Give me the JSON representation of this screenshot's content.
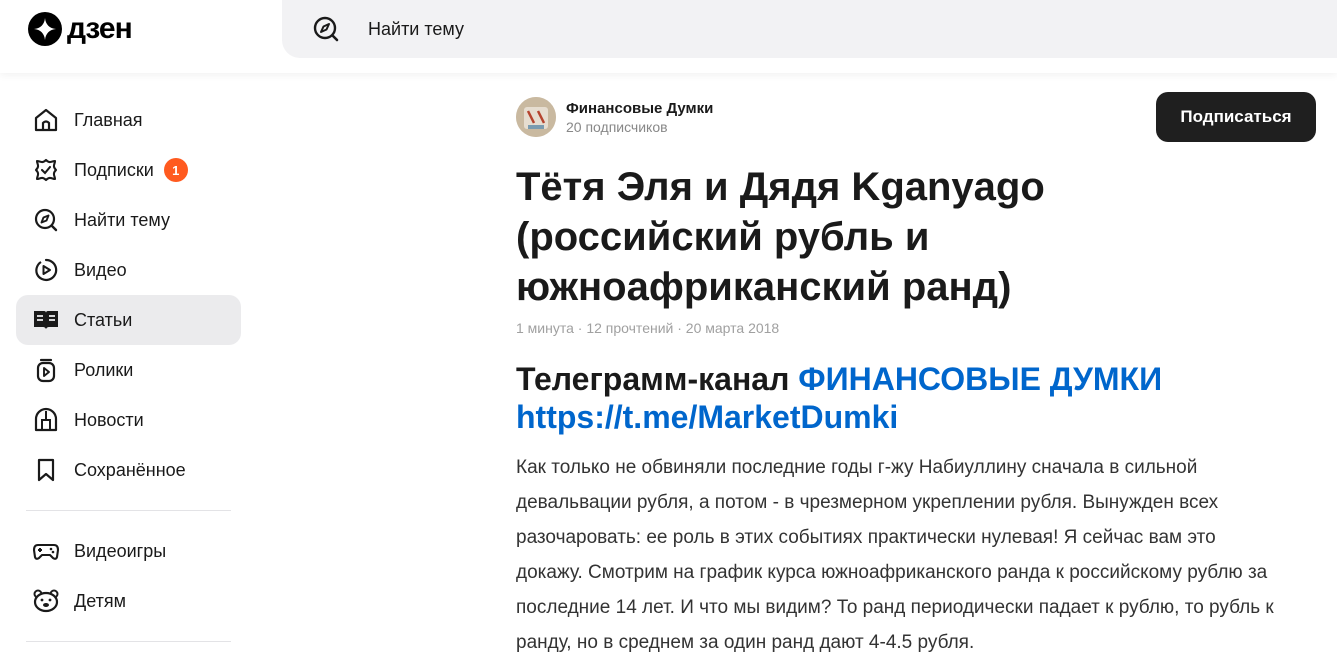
{
  "header": {
    "logo_text": "дзен",
    "search_placeholder": "Найти тему"
  },
  "sidebar": {
    "items": [
      {
        "label": "Главная",
        "icon": "home-icon"
      },
      {
        "label": "Подписки",
        "icon": "subscriptions-icon",
        "badge": "1"
      },
      {
        "label": "Найти тему",
        "icon": "compass-icon"
      },
      {
        "label": "Видео",
        "icon": "video-icon"
      },
      {
        "label": "Статьи",
        "icon": "articles-icon",
        "active": true
      },
      {
        "label": "Ролики",
        "icon": "shorts-icon"
      },
      {
        "label": "Новости",
        "icon": "news-icon"
      },
      {
        "label": "Сохранённое",
        "icon": "bookmark-icon"
      }
    ],
    "extra_items": [
      {
        "label": "Видеоигры",
        "icon": "gamepad-icon"
      },
      {
        "label": "Детям",
        "icon": "kids-icon"
      }
    ]
  },
  "channel": {
    "name": "Финансовые Думки",
    "subscribers": "20 подписчиков"
  },
  "subscribe_label": "Подписаться",
  "article": {
    "title": "Тётя Эля и Дядя Kganyago (российский рубль и южноафриканский ранд)",
    "meta": "1 минута · 12 прочтений · 20 марта 2018",
    "subhead_prefix": "Телеграмм-канал ",
    "subhead_link_text": "ФИНАНСОВЫЕ ДУМКИ",
    "subhead_url": "https://t.me/MarketDumki",
    "body": "Как только не обвиняли последние годы г-жу Набиуллину сначала в сильной девальвации рубля, а потом - в чрезмерном укреплении рубля. Вынужден всех разочаровать: ее роль в этих событиях практически нулевая! Я сейчас вам это докажу. Смотрим на график курса южноафриканского ранда к российскому рублю за последние 14 лет. И что мы видим? То ранд периодически падает к рублю, то рубль к ранду, но в среднем за один ранд дают 4-4.5 рубля."
  },
  "colors": {
    "accent_link": "#0066cc",
    "badge": "#ff5a1f",
    "button_bg": "#1f1f1f"
  }
}
